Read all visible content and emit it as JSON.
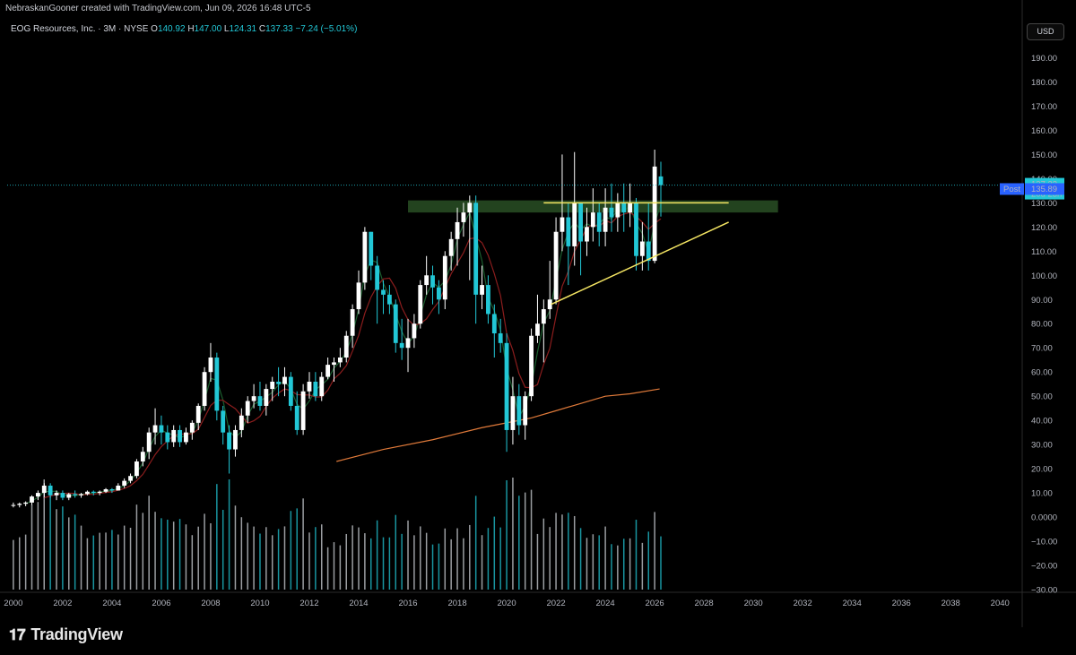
{
  "header": {
    "credit": "NebraskanGooner created with TradingView.com, Jun 09, 2026 16:48 UTC-5"
  },
  "symbol": {
    "name": "EOG Resources, Inc. · 3M · NYSE",
    "o_label": "O",
    "o": "140.92",
    "h_label": "H",
    "h": "147.00",
    "l_label": "L",
    "l": "124.31",
    "c_label": "C",
    "c": "137.33",
    "change": "−7.24 (−5.01%)"
  },
  "currency_button": "USD",
  "last_price": {
    "price": "137.33",
    "countdown": "20d 23h"
  },
  "post_price": {
    "label": "Post",
    "price": "135.89"
  },
  "branding": {
    "logo_text": "TradingView"
  },
  "colors": {
    "background": "#000000",
    "up": "#ffffff",
    "down": "#22c7d6",
    "ma_fast": "#1a5e2e",
    "ma_mid": "#8b1d1d",
    "ma_slow": "#e07a3a",
    "trendline": "#f5e663",
    "zone": "#2f5a2a"
  },
  "chart_data": {
    "type": "candlestick",
    "interval": "3M",
    "ylim": [
      -30,
      195
    ],
    "xlim": [
      "1999-10",
      "2040-12"
    ],
    "y_ticks": [
      "190.00",
      "180.00",
      "170.00",
      "160.00",
      "150.00",
      "140.00",
      "130.00",
      "120.00",
      "110.00",
      "100.00",
      "90.00",
      "80.00",
      "70.00",
      "60.00",
      "50.00",
      "40.00",
      "30.00",
      "20.00",
      "10.00",
      "0.0000",
      "−10.00",
      "−20.00",
      "−30.00"
    ],
    "x_ticks": [
      "2000",
      "2002",
      "2004",
      "2006",
      "2008",
      "2010",
      "2012",
      "2014",
      "2016",
      "2018",
      "2020",
      "2022",
      "2024",
      "2026",
      "2028",
      "2030",
      "2032",
      "2034",
      "2036",
      "2038",
      "2040"
    ],
    "candles": [
      [
        2000.0,
        5,
        6,
        4,
        5
      ],
      [
        2000.25,
        5,
        6,
        4,
        5.5
      ],
      [
        2000.5,
        5.5,
        6.5,
        4.5,
        6
      ],
      [
        2000.75,
        6,
        9,
        5,
        8.5
      ],
      [
        2001.0,
        8.5,
        11,
        7,
        10
      ],
      [
        2001.25,
        10,
        14,
        8,
        13
      ],
      [
        2001.5,
        13,
        14,
        8,
        9
      ],
      [
        2001.75,
        9,
        11,
        7,
        10
      ],
      [
        2002.0,
        10,
        11,
        7,
        8
      ],
      [
        2002.25,
        8,
        10,
        7,
        9.5
      ],
      [
        2002.5,
        9.5,
        11,
        8,
        9
      ],
      [
        2002.75,
        9,
        10,
        8,
        9.5
      ],
      [
        2003.0,
        9.5,
        11,
        9,
        10.5
      ],
      [
        2003.25,
        10.5,
        11,
        9,
        10
      ],
      [
        2003.5,
        10,
        11,
        9,
        10.5
      ],
      [
        2003.75,
        10.5,
        12,
        10,
        11.5
      ],
      [
        2004.0,
        11.5,
        12,
        10,
        11
      ],
      [
        2004.25,
        11,
        14,
        11,
        13
      ],
      [
        2004.5,
        13,
        16,
        12,
        15
      ],
      [
        2004.75,
        15,
        18,
        14,
        17
      ],
      [
        2005.0,
        17,
        24,
        16,
        23
      ],
      [
        2005.25,
        23,
        29,
        21,
        27
      ],
      [
        2005.5,
        27,
        37,
        24,
        35
      ],
      [
        2005.75,
        35,
        45,
        30,
        38
      ],
      [
        2006.0,
        38,
        42,
        30,
        35
      ],
      [
        2006.25,
        35,
        38,
        28,
        31
      ],
      [
        2006.5,
        31,
        38,
        29,
        36
      ],
      [
        2006.75,
        36,
        38,
        29,
        31
      ],
      [
        2007.0,
        31,
        37,
        30,
        35
      ],
      [
        2007.25,
        35,
        40,
        32,
        39
      ],
      [
        2007.5,
        39,
        47,
        36,
        46
      ],
      [
        2007.75,
        46,
        62,
        44,
        60
      ],
      [
        2008.0,
        60,
        72,
        56,
        66
      ],
      [
        2008.25,
        66,
        68,
        40,
        44
      ],
      [
        2008.5,
        44,
        46,
        30,
        35
      ],
      [
        2008.75,
        35,
        38,
        18,
        28
      ],
      [
        2009.0,
        28,
        38,
        25,
        36
      ],
      [
        2009.25,
        36,
        45,
        33,
        42
      ],
      [
        2009.5,
        42,
        50,
        39,
        48
      ],
      [
        2009.75,
        48,
        55,
        45,
        50
      ],
      [
        2010.0,
        50,
        56,
        44,
        46
      ],
      [
        2010.25,
        46,
        55,
        42,
        53
      ],
      [
        2010.5,
        53,
        58,
        48,
        56
      ],
      [
        2010.75,
        56,
        62,
        50,
        55
      ],
      [
        2011.0,
        55,
        62,
        50,
        58
      ],
      [
        2011.25,
        58,
        60,
        44,
        46
      ],
      [
        2011.5,
        46,
        52,
        34,
        36
      ],
      [
        2011.75,
        36,
        55,
        34,
        52
      ],
      [
        2012.0,
        52,
        60,
        49,
        56
      ],
      [
        2012.25,
        56,
        60,
        48,
        50
      ],
      [
        2012.5,
        50,
        60,
        48,
        58
      ],
      [
        2012.75,
        58,
        66,
        57,
        63
      ],
      [
        2013.0,
        63,
        66,
        56,
        64
      ],
      [
        2013.25,
        64,
        70,
        62,
        66
      ],
      [
        2013.5,
        66,
        77,
        64,
        75
      ],
      [
        2013.75,
        75,
        88,
        70,
        86
      ],
      [
        2014.0,
        86,
        102,
        84,
        97
      ],
      [
        2014.25,
        97,
        120,
        94,
        118
      ],
      [
        2014.5,
        118,
        118,
        98,
        104
      ],
      [
        2014.75,
        104,
        108,
        80,
        94
      ],
      [
        2015.0,
        94,
        98,
        84,
        92
      ],
      [
        2015.25,
        92,
        96,
        84,
        88
      ],
      [
        2015.5,
        88,
        90,
        68,
        72
      ],
      [
        2015.75,
        72,
        82,
        65,
        70
      ],
      [
        2016.0,
        70,
        82,
        60,
        74
      ],
      [
        2016.25,
        74,
        84,
        70,
        80
      ],
      [
        2016.5,
        80,
        98,
        78,
        96
      ],
      [
        2016.75,
        96,
        108,
        92,
        100
      ],
      [
        2017.0,
        100,
        104,
        88,
        95
      ],
      [
        2017.25,
        95,
        98,
        84,
        90
      ],
      [
        2017.5,
        90,
        110,
        86,
        108
      ],
      [
        2017.75,
        108,
        118,
        102,
        115
      ],
      [
        2018.0,
        115,
        128,
        104,
        122
      ],
      [
        2018.25,
        122,
        130,
        116,
        126
      ],
      [
        2018.5,
        126,
        133,
        98,
        130
      ],
      [
        2018.75,
        130,
        133,
        80,
        92
      ],
      [
        2019.0,
        92,
        104,
        86,
        96
      ],
      [
        2019.25,
        96,
        100,
        80,
        84
      ],
      [
        2019.5,
        84,
        88,
        66,
        76
      ],
      [
        2019.75,
        76,
        82,
        68,
        72
      ],
      [
        2020.0,
        72,
        76,
        27,
        36
      ],
      [
        2020.25,
        36,
        58,
        30,
        50
      ],
      [
        2020.5,
        50,
        55,
        34,
        38
      ],
      [
        2020.75,
        38,
        52,
        32,
        50
      ],
      [
        2021.0,
        50,
        78,
        48,
        75
      ],
      [
        2021.25,
        75,
        92,
        72,
        80
      ],
      [
        2021.5,
        80,
        90,
        64,
        86
      ],
      [
        2021.75,
        86,
        106,
        82,
        90
      ],
      [
        2022.0,
        90,
        124,
        88,
        118
      ],
      [
        2022.25,
        118,
        150,
        110,
        124
      ],
      [
        2022.5,
        124,
        130,
        96,
        112
      ],
      [
        2022.75,
        112,
        151,
        104,
        130
      ],
      [
        2023.0,
        130,
        130,
        100,
        114
      ],
      [
        2023.25,
        114,
        128,
        108,
        120
      ],
      [
        2023.5,
        120,
        136,
        114,
        126
      ],
      [
        2023.75,
        126,
        130,
        112,
        118
      ],
      [
        2024.0,
        118,
        136,
        112,
        128
      ],
      [
        2024.25,
        128,
        138,
        118,
        124
      ],
      [
        2024.5,
        124,
        134,
        118,
        130
      ],
      [
        2024.75,
        130,
        138,
        118,
        126
      ],
      [
        2025.0,
        126,
        138,
        120,
        130
      ],
      [
        2025.25,
        130,
        132,
        102,
        108
      ],
      [
        2025.5,
        108,
        122,
        102,
        114
      ],
      [
        2025.75,
        114,
        130,
        102,
        106
      ],
      [
        2026.0,
        106,
        152,
        105,
        145
      ],
      [
        2026.25,
        140.92,
        147,
        124.31,
        137.33
      ]
    ],
    "annotations": {
      "resistance_zone": {
        "from": "2016",
        "to": "2031",
        "low": 126,
        "high": 131
      },
      "horizontal_line": {
        "from": "2021.5",
        "to": "2029",
        "y": 130
      },
      "ascending_trendline": [
        [
          "2021.8",
          88
        ],
        [
          "2029",
          122
        ]
      ]
    }
  }
}
